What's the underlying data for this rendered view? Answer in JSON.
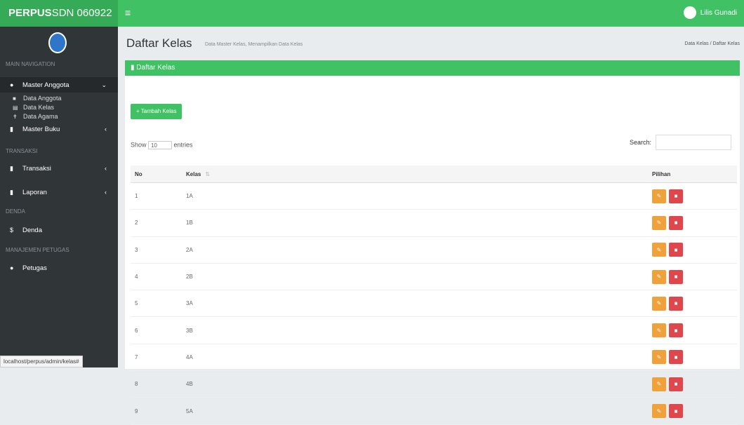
{
  "brand": {
    "bold": "PERPUS",
    "rest": "SDN 060922"
  },
  "topbar": {
    "toggle": "≡",
    "user": "Lilis Gunadi"
  },
  "sidebar": {
    "header_main": "MAIN NAVIGATION",
    "master_anggota": "Master Anggota",
    "sub": [
      "Data Anggota",
      "Data Kelas",
      "Data Agama"
    ],
    "master_buku": "Master Buku",
    "header_transaksi": "TRANSAKSI",
    "transaksi": "Transaksi",
    "laporan": "Laporan",
    "header_denda": "DENDA",
    "denda": "Denda",
    "header_petugas": "MANAJEMEN PETUGAS",
    "petugas": "Petugas"
  },
  "status_url": "localhost/perpus/admin/kelas#",
  "page": {
    "title": "Daftar Kelas",
    "subtitle": "Data Master Kelas, Menampilkan Data Kelas",
    "crumb": "Data Kelas  /  Daftar Kelas"
  },
  "card": {
    "header": "Daftar Kelas",
    "add_label": "+ Tambah Kelas",
    "show_prefix": "Show",
    "show_value": "10",
    "show_suffix": "entries",
    "search_label": "Search:"
  },
  "table": {
    "headers": [
      "No",
      "Kelas",
      "Pilihan"
    ],
    "rows": [
      {
        "no": "1",
        "kelas": "1A"
      },
      {
        "no": "2",
        "kelas": "1B"
      },
      {
        "no": "3",
        "kelas": "2A"
      },
      {
        "no": "4",
        "kelas": "2B"
      },
      {
        "no": "5",
        "kelas": "3A"
      },
      {
        "no": "6",
        "kelas": "3B"
      },
      {
        "no": "7",
        "kelas": "4A"
      },
      {
        "no": "8",
        "kelas": "4B"
      },
      {
        "no": "9",
        "kelas": "5A"
      }
    ]
  },
  "colors": {
    "accent": "#3fc164",
    "sidebar": "#303538",
    "edit": "#f0a13a",
    "delete": "#e0474c"
  }
}
